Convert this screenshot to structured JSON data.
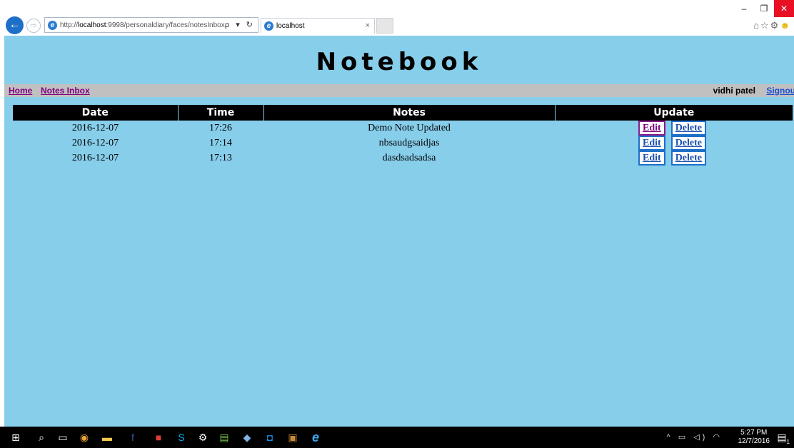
{
  "browser": {
    "url_prefix": "http://",
    "url_host": "localhost",
    "url_rest": ":9998/personaldiary/faces/notesInbox.",
    "address_tools": "ρ ▾ ↻",
    "tab_title": "localhost",
    "tab_close": "×",
    "win_minimize": "–",
    "win_restore": "❐",
    "win_close": "✕"
  },
  "page": {
    "title": "Notebook",
    "nav": {
      "home": "Home",
      "notes_inbox": "Notes Inbox",
      "user": "vidhi patel",
      "signout": "Signout"
    },
    "table": {
      "headers": [
        "Date",
        "Time",
        "Notes",
        "Update"
      ],
      "rows": [
        {
          "date": "2016-12-07",
          "time": "17:26",
          "note": "Demo Note Updated",
          "edit": "Edit",
          "delete": "Delete"
        },
        {
          "date": "2016-12-07",
          "time": "17:14",
          "note": "nbsaudgsaidjas",
          "edit": "Edit",
          "delete": "Delete"
        },
        {
          "date": "2016-12-07",
          "time": "17:13",
          "note": "dasdsadsadsa",
          "edit": "Edit",
          "delete": "Delete"
        }
      ]
    }
  },
  "taskbar": {
    "time": "5:27 PM",
    "date": "12/7/2016",
    "badge_count": "1"
  },
  "colors": {
    "page_background": "#87ceeb",
    "menubar": "#c0c0c0",
    "header_bg": "#000000",
    "visited_link": "#800080",
    "link": "#1a4fd6"
  }
}
